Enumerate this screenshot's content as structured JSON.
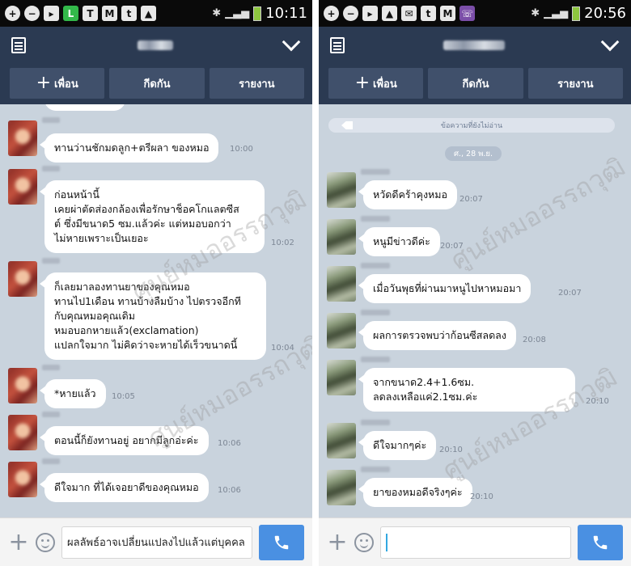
{
  "left": {
    "status_time": "10:11",
    "status_icons": [
      "add-icon",
      "minus-icon",
      "app-icon",
      "line-app-icon",
      "t-icon",
      "mail-icon",
      "talk-icon",
      "image-icon",
      "bluetooth-icon",
      "signal-icon",
      "battery-icon"
    ],
    "header": {
      "title": "A A"
    },
    "actions": {
      "add_friend": "เพื่อน",
      "block": "กีดกัน",
      "report": "รายงาน"
    },
    "messages": [
      {
        "text": "ทานว่านชักมดลูก+ตรีผลา ของหมอ",
        "time": "10:00"
      },
      {
        "text": "ก่อนหน้านี้\nเคยผ่าตัดส่องกล้องเพื่อรักษาช็อคโกแลตซีส\nต์ ซึ่งมีขนาด5 ซม.แล้วค่ะ  แต่หมอบอกว่า\nไม่หายเพราะเป็นเยอะ",
        "time": "10:02"
      },
      {
        "text": "ก็เลยมาลองทานยาของคุณหมอ\nทานไป1เดือน ทานบ้างลืมบ้าง ไปตรวจอีกที\nกับคุณหมอคุณเดิม\nหมอบอกหายแล้ว(exclamation)\nแปลกใจมาก ไม่คิดว่าจะหายได้เร็วขนาดนี้",
        "time": "10:04"
      },
      {
        "text": "*หายแล้ว",
        "time": "10:05"
      },
      {
        "text": "ตอนนี้ก็ยังทานอยู่ อยากมีลูกอ่ะค่ะ",
        "time": "10:06"
      },
      {
        "text": "ดีใจมาก ที่ได้เจอยาดีของคุณหมอ",
        "time": "10:06"
      }
    ],
    "input": {
      "value": "ผลลัพธ์อาจเปลี่ยนแปลงไปแล้วแต่บุคคล"
    }
  },
  "right": {
    "status_time": "20:56",
    "status_icons": [
      "add-icon",
      "minus-icon",
      "app-icon",
      "image-icon",
      "mail-icon",
      "talk-icon",
      "mail-icon",
      "viber-icon",
      "bluetooth-icon",
      "signal-icon",
      "battery-icon"
    ],
    "header": {
      "title": "Sanit"
    },
    "actions": {
      "add_friend": "เพื่อน",
      "block": "กีดกัน",
      "report": "รายงาน"
    },
    "unread_label": "ข้อความที่ยังไม่อ่าน",
    "date_label": "ศ., 28 พ.ย.",
    "messages": [
      {
        "text": "หวัดดีคร้าคุงหมอ",
        "time": "20:07"
      },
      {
        "text": "หนูมีข่าวดีค่ะ",
        "time": "20:07"
      },
      {
        "text": "เมื่อวันพุธที่ผ่านมาหนูไปหาหมอมา",
        "time": "20:07"
      },
      {
        "text": "ผลการตรวจพบว่าก้อนซีสลดลง",
        "time": "20:08"
      },
      {
        "text": "จากขนาด2.4+1.6ซม.\nลดลงเหลือแค่2.1ซม.ค่ะ",
        "time": "20:10"
      },
      {
        "text": "ดีใจมากๆค่ะ",
        "time": "20:10"
      },
      {
        "text": "ยาของหมอดีจริงๆค่ะ",
        "time": "20:10"
      }
    ],
    "input": {
      "value": ""
    }
  },
  "watermark": "ศูนย์หมออรรถวุฒิ"
}
